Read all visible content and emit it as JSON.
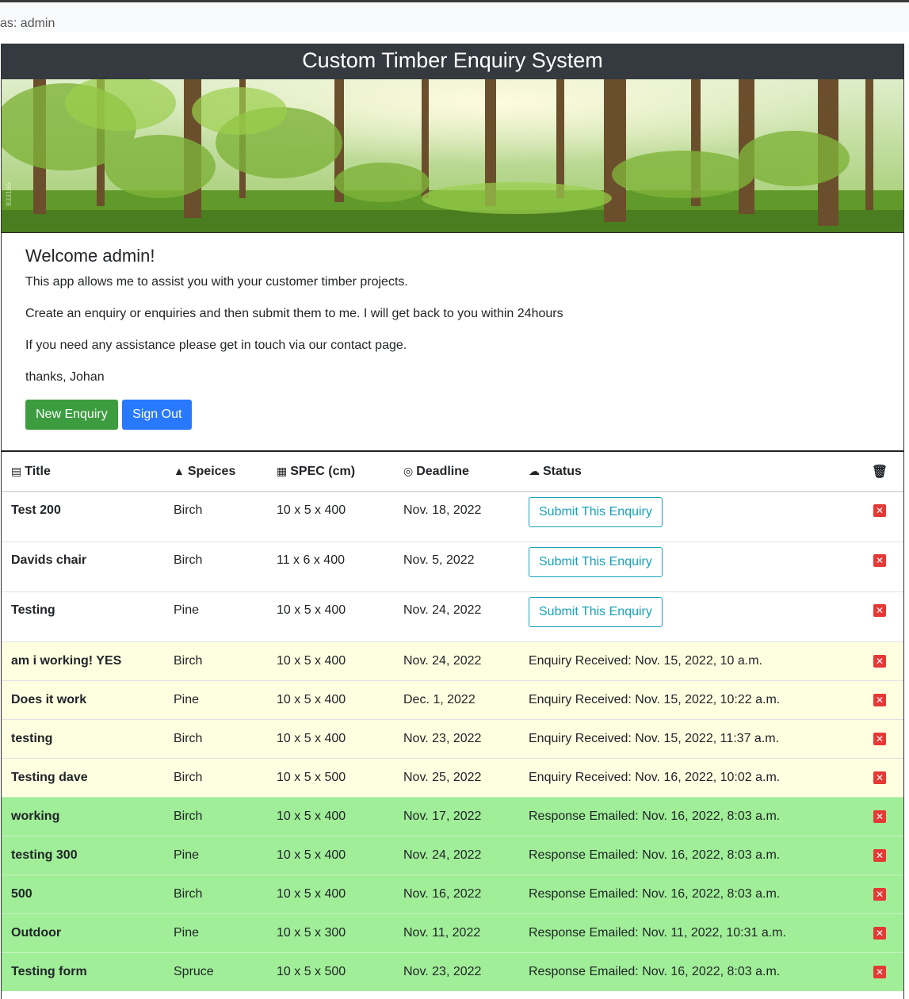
{
  "topbar": {
    "user_text": "as: admin"
  },
  "header": {
    "title": "Custom Timber Enquiry System"
  },
  "banner": {
    "watermark": "833165"
  },
  "welcome": {
    "heading": "Welcome admin!",
    "p1": "This app allows me to assist you with your customer timber projects.",
    "p2": "Create an enquiry or enquiries and then submit them to me. I will get back to you within 24hours",
    "p3": "If you need any assistance please get in touch via our contact page.",
    "p4": "thanks, Johan",
    "new_enquiry": "New Enquiry",
    "sign_out": "Sign Out"
  },
  "table": {
    "headers": {
      "title": "Title",
      "species": "Speices",
      "spec": "SPEC (cm)",
      "deadline": "Deadline",
      "status": "Status"
    },
    "submit_label": "Submit This Enquiry",
    "rows": [
      {
        "title": "Test 200",
        "species": "Birch",
        "spec": "10 x 5 x 400",
        "deadline": "Nov. 18, 2022",
        "status": ""
      },
      {
        "title": "Davids chair",
        "species": "Birch",
        "spec": "11 x 6 x 400",
        "deadline": "Nov. 5, 2022",
        "status": ""
      },
      {
        "title": "Testing",
        "species": "Pine",
        "spec": "10 x 5 x 400",
        "deadline": "Nov. 24, 2022",
        "status": ""
      },
      {
        "title": "am i working! YES",
        "species": "Birch",
        "spec": "10 x 5 x 400",
        "deadline": "Nov. 24, 2022",
        "status": "Enquiry Received: Nov. 15, 2022, 10 a.m."
      },
      {
        "title": "Does it work",
        "species": "Pine",
        "spec": "10 x 5 x 400",
        "deadline": "Dec. 1, 2022",
        "status": "Enquiry Received: Nov. 15, 2022, 10:22 a.m."
      },
      {
        "title": "testing",
        "species": "Birch",
        "spec": "10 x 5 x 400",
        "deadline": "Nov. 23, 2022",
        "status": "Enquiry Received: Nov. 15, 2022, 11:37 a.m."
      },
      {
        "title": "Testing dave",
        "species": "Birch",
        "spec": "10 x 5 x 500",
        "deadline": "Nov. 25, 2022",
        "status": "Enquiry Received: Nov. 16, 2022, 10:02 a.m."
      },
      {
        "title": "working",
        "species": "Birch",
        "spec": "10 x 5 x 400",
        "deadline": "Nov. 17, 2022",
        "status": "Response Emailed: Nov. 16, 2022, 8:03 a.m."
      },
      {
        "title": "testing 300",
        "species": "Pine",
        "spec": "10 x 5 x 400",
        "deadline": "Nov. 24, 2022",
        "status": "Response Emailed: Nov. 16, 2022, 8:03 a.m."
      },
      {
        "title": "500",
        "species": "Birch",
        "spec": "10 x 5 x 400",
        "deadline": "Nov. 16, 2022",
        "status": "Response Emailed: Nov. 16, 2022, 8:03 a.m."
      },
      {
        "title": "Outdoor",
        "species": "Pine",
        "spec": "10 x 5 x 300",
        "deadline": "Nov. 11, 2022",
        "status": "Response Emailed: Nov. 11, 2022, 10:31 a.m."
      },
      {
        "title": "Testing form",
        "species": "Spruce",
        "spec": "10 x 5 x 500",
        "deadline": "Nov. 23, 2022",
        "status": "Response Emailed: Nov. 16, 2022, 8:03 a.m."
      }
    ]
  },
  "colors": {
    "received_bg": "#fefee0",
    "emailed_bg": "#a0ee98",
    "header_bg": "#343a40"
  },
  "icons": {
    "title": "file-chart-icon",
    "species": "tree-icon",
    "spec": "ruler-icon",
    "deadline": "target-icon",
    "status": "cloud-upload-icon",
    "delete": "trash-icon"
  }
}
